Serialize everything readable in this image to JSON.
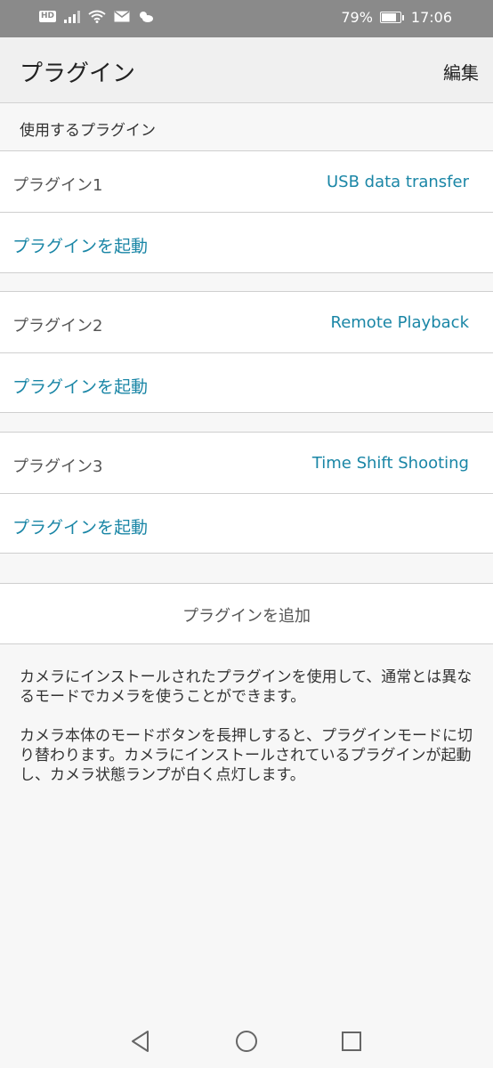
{
  "status_bar": {
    "battery_percent": "79%",
    "battery_level": 0.79,
    "time": "17:06",
    "icons": [
      "hd-icon",
      "signal-icon",
      "wifi-icon",
      "mail-icon",
      "weather-icon",
      "battery-icon"
    ]
  },
  "header": {
    "title": "プラグイン",
    "edit_label": "編集"
  },
  "section": {
    "title": "使用するプラグイン"
  },
  "plugins": [
    {
      "label": "プラグイン1",
      "name": "USB data transfer",
      "launch_label": "プラグインを起動"
    },
    {
      "label": "プラグイン2",
      "name": "Remote Playback",
      "launch_label": "プラグインを起動"
    },
    {
      "label": "プラグイン3",
      "name": "Time Shift Shooting",
      "launch_label": "プラグインを起動"
    }
  ],
  "add_plugin_label": "プラグインを追加",
  "description": {
    "paragraph1": "カメラにインストールされたプラグインを使用して、通常とは異なるモードでカメラを使うことができます。",
    "paragraph2": "カメラ本体のモードボタンを長押しすると、プラグインモードに切り替わります。カメラにインストールされているプラグインが起動し、カメラ状態ランプが白く点灯します。"
  },
  "nav_bar": {
    "icons": [
      "back-icon",
      "home-icon",
      "recent-apps-icon"
    ]
  },
  "colors": {
    "accent": "#1a86a6",
    "status_bar": "#8a8a8a"
  }
}
